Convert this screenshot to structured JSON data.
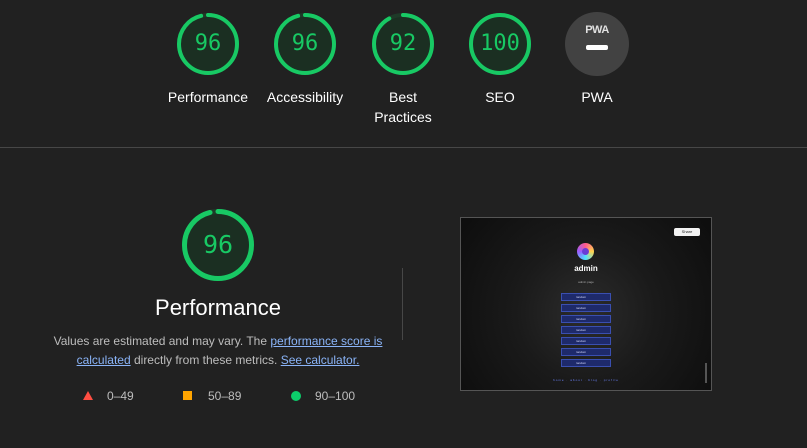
{
  "categories": [
    {
      "id": "performance",
      "score": "96",
      "label": "Performance",
      "fraction": 0.96
    },
    {
      "id": "accessibility",
      "score": "96",
      "label": "Accessibility",
      "fraction": 0.96
    },
    {
      "id": "best-practices",
      "score": "92",
      "label": "Best Practices",
      "fraction": 0.92
    },
    {
      "id": "seo",
      "score": "100",
      "label": "SEO",
      "fraction": 1.0
    },
    {
      "id": "pwa",
      "score": "PWA",
      "label": "PWA"
    }
  ],
  "performance_detail": {
    "score": "96",
    "fraction": 0.96,
    "title": "Performance",
    "desc_part1": "Values are estimated and may vary. The ",
    "link_score": "performance score is calculated",
    "desc_part2": " directly from these metrics. ",
    "link_calc": "See calculator."
  },
  "legend": [
    {
      "range": "0–49",
      "color": "#ff4e42"
    },
    {
      "range": "50–89",
      "color": "#ffa400"
    },
    {
      "range": "90–100",
      "color": "#0cce6b"
    }
  ],
  "screenshot": {
    "share_label": "Share",
    "name": "admin",
    "subtitle": "admin page",
    "buttons": [
      "random",
      "random",
      "random",
      "random",
      "random",
      "random",
      "random"
    ],
    "footer": "home · about · blog · profile"
  },
  "colors": {
    "pass": "#18c964",
    "pass_track": "#1e3a28",
    "background": "#212121"
  }
}
